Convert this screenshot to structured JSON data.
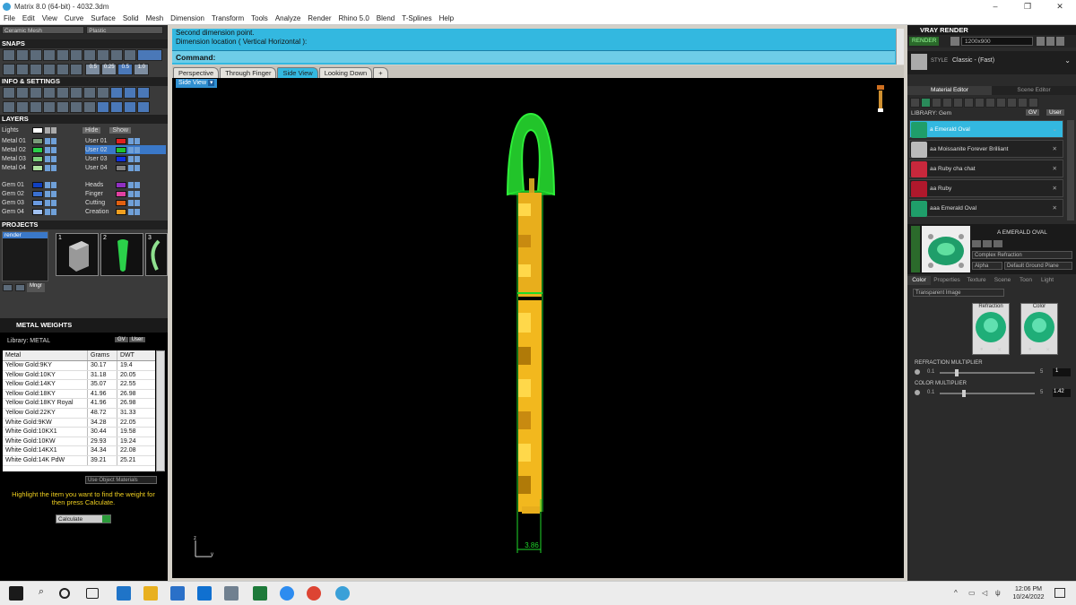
{
  "window": {
    "title": "Matrix 8.0 (64-bit) - 4032.3dm"
  },
  "menu": [
    "File",
    "Edit",
    "View",
    "Curve",
    "Surface",
    "Solid",
    "Mesh",
    "Dimension",
    "Transform",
    "Tools",
    "Analyze",
    "Render",
    "Rhino 5.0",
    "Blend",
    "T-Splines",
    "Help"
  ],
  "left": {
    "combos": [
      "Ceramic Mesh",
      "Plastic"
    ],
    "snaps": "SNAPS",
    "info": "INFO & SETTINGS",
    "layers_title": "LAYERS",
    "snap_values": [
      "0.5",
      "0.25",
      "0.5",
      "1.0"
    ],
    "lights": "Lights",
    "hide": "Hide",
    "show": "Show",
    "layers_left": [
      "Metal 01",
      "Metal 02",
      "Metal 03",
      "Metal 04",
      "Gem 01",
      "Gem 02",
      "Gem 03",
      "Gem 04"
    ],
    "layers_right": [
      "User 01",
      "User 02",
      "User 03",
      "User 04",
      "Heads",
      "Finger",
      "Cutting",
      "Creation"
    ],
    "projects_title": "PROJECTS",
    "project_item": "render",
    "thumb_nums": [
      "1",
      "2",
      "3"
    ],
    "mngr": "Mngr"
  },
  "weights": {
    "title": "METAL WEIGHTS",
    "library": "Library: METAL",
    "lib_btns": [
      "GV",
      "User"
    ],
    "headers": [
      "Metal",
      "Grams",
      "DWT"
    ],
    "rows": [
      [
        "Yellow Gold:9KY",
        "30.17",
        "19.4"
      ],
      [
        "Yellow Gold:10KY",
        "31.18",
        "20.05"
      ],
      [
        "Yellow Gold:14KY",
        "35.07",
        "22.55"
      ],
      [
        "Yellow Gold:18KY",
        "41.96",
        "26.98"
      ],
      [
        "Yellow Gold:18KY Royal",
        "41.96",
        "26.98"
      ],
      [
        "Yellow Gold:22KY",
        "48.72",
        "31.33"
      ],
      [
        "White Gold:9KW",
        "34.28",
        "22.05"
      ],
      [
        "White Gold:10KX1",
        "30.44",
        "19.58"
      ],
      [
        "White Gold:10KW",
        "29.93",
        "19.24"
      ],
      [
        "White Gold:14KX1",
        "34.34",
        "22.08"
      ],
      [
        "White Gold:14K PdW",
        "39.21",
        "25.21"
      ]
    ],
    "use_obj": "Use Object Materials",
    "hint": "Highlight the item you want to find the weight for then press Calculate.",
    "calc": "Calculate"
  },
  "command": {
    "line1": "Second dimension point.",
    "line2": "Dimension location ( Vertical  Horizontal ):",
    "label": "Command:"
  },
  "viewtabs": [
    "Perspective",
    "Through Finger",
    "Side View",
    "Looking Down"
  ],
  "viewport": {
    "label": "Side View",
    "dimension": "3.86",
    "axis_z": "z",
    "axis_y": "y"
  },
  "vray": {
    "title": "VRAY RENDER",
    "render_btn": "RENDER",
    "resolution": "1200x900",
    "style_label": "STYLE",
    "style_value": "Classic - (Fast)",
    "tabs": [
      "Material Editor",
      "Scene Editor"
    ],
    "library": "LIBRARY: Gem",
    "lib_btns": [
      "GV",
      "User"
    ],
    "materials": [
      {
        "name": "a Emerald Oval",
        "color": "#1f9e6a"
      },
      {
        "name": "aa Moissanite Forever Brilliant",
        "color": "#bbbbbb"
      },
      {
        "name": "aa Ruby cha chat",
        "color": "#c8283c"
      },
      {
        "name": "aa Ruby",
        "color": "#b0182c"
      },
      {
        "name": "aaa Emerald Oval",
        "color": "#1f9e6a"
      }
    ],
    "selected_name": "A EMERALD OVAL",
    "material_type": "Complex Refraction",
    "alpha": "Alpha",
    "ground": "Default Ground Plane",
    "subtabs": [
      "Color",
      "Properties",
      "Texture",
      "Scene",
      "Toon",
      "Light"
    ],
    "transparent": "Transparent Image",
    "swatch_labels": [
      "Refraction",
      "Color"
    ],
    "refraction_mult": "REFRACTION MULTIPLIER",
    "refraction_range": [
      "0.1",
      "5"
    ],
    "refraction_val": "1",
    "color_mult": "COLOR MULTIPLIER",
    "color_range": [
      "0.1",
      "5"
    ],
    "color_val": "1.42"
  },
  "taskbar": {
    "time": "12:06 PM",
    "date": "10/24/2022"
  }
}
